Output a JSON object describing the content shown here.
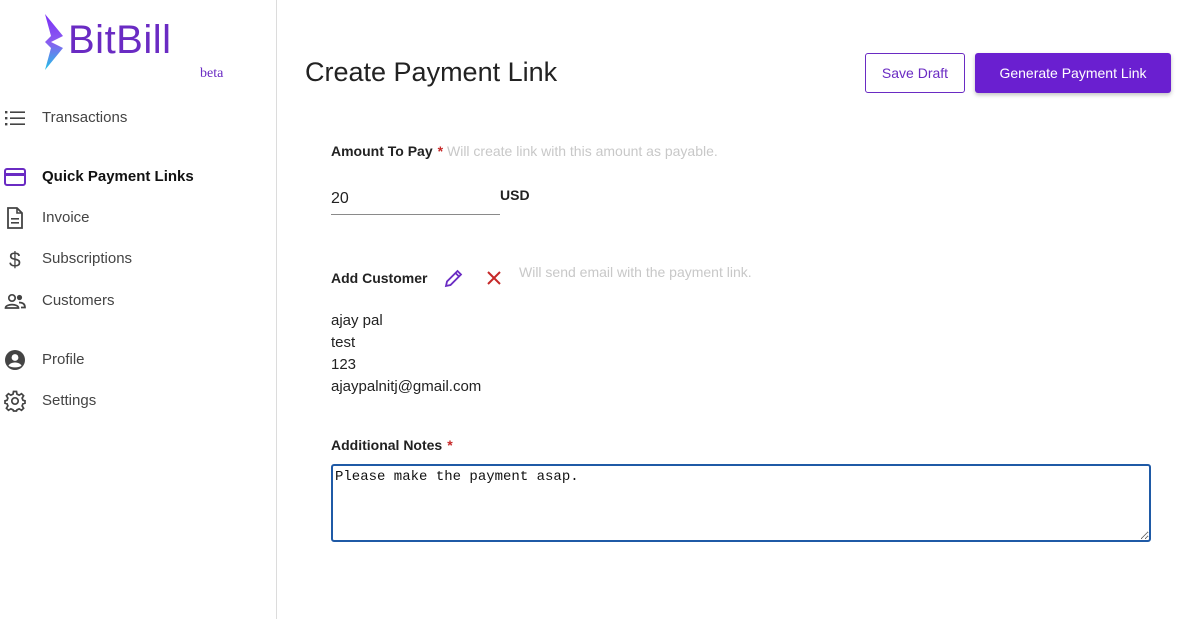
{
  "brand": {
    "name": "BitBill",
    "badge": "beta",
    "colors": {
      "primary": "#6a2bc3",
      "gradient_top": "#7b2ff7",
      "gradient_bottom": "#22c3e6"
    }
  },
  "sidebar": {
    "items": [
      {
        "label": "Transactions",
        "icon": "list-icon",
        "active": false
      },
      {
        "label": "Quick Payment Links",
        "icon": "card-icon",
        "active": true
      },
      {
        "label": "Invoice",
        "icon": "document-icon",
        "active": false
      },
      {
        "label": "Subscriptions",
        "icon": "dollar-icon",
        "active": false
      },
      {
        "label": "Customers",
        "icon": "people-icon",
        "active": false
      },
      {
        "label": "Profile",
        "icon": "account-circle-icon",
        "active": false
      },
      {
        "label": "Settings",
        "icon": "gear-icon",
        "active": false
      }
    ]
  },
  "header": {
    "title": "Create Payment Link",
    "save_draft_label": "Save Draft",
    "generate_label": "Generate Payment Link"
  },
  "form": {
    "amount": {
      "label": "Amount To Pay",
      "required_mark": "*",
      "hint": "Will create link with this amount as payable.",
      "value": "20",
      "currency": "USD"
    },
    "customer": {
      "label": "Add Customer",
      "hint": "Will send email with the payment link.",
      "edit_icon": "pencil-icon",
      "remove_icon": "close-icon",
      "details": [
        "ajay pal",
        "test",
        "123",
        "ajaypalnitj@gmail.com"
      ]
    },
    "notes": {
      "label": "Additional Notes",
      "required_mark": "*",
      "value": "Please make the payment asap."
    }
  }
}
